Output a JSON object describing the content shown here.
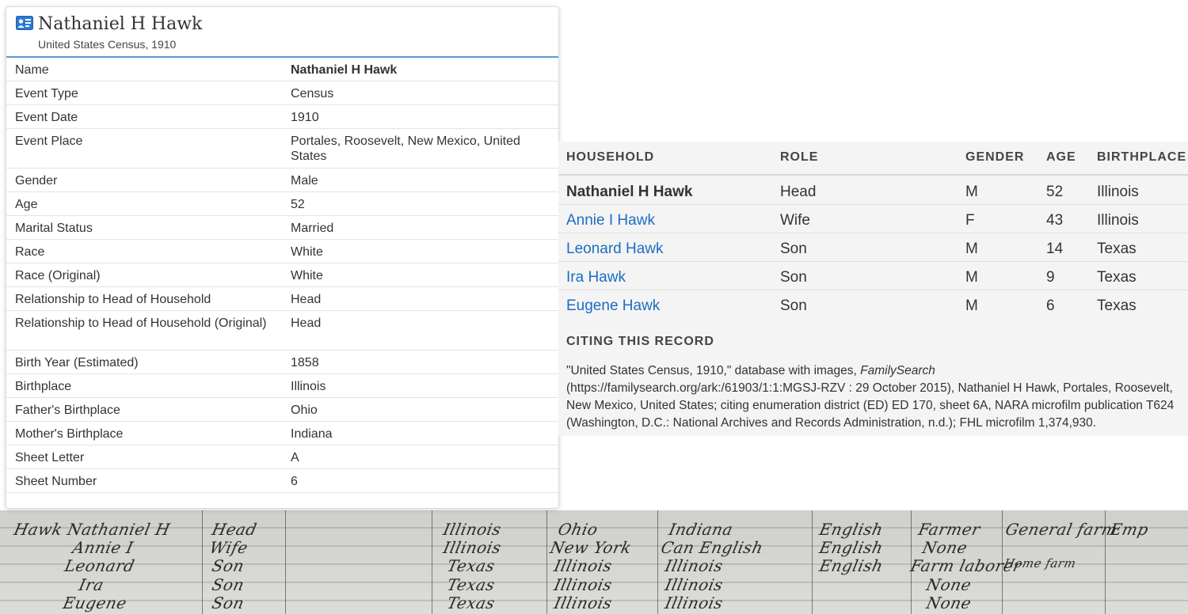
{
  "record": {
    "title": "Nathaniel H Hawk",
    "subtitle": "United States Census, 1910",
    "fields": [
      {
        "label": "Name",
        "value": "Nathaniel H Hawk"
      },
      {
        "label": "Event Type",
        "value": "Census"
      },
      {
        "label": "Event Date",
        "value": "1910"
      },
      {
        "label": "Event Place",
        "value": "Portales, Roosevelt, New Mexico, United States"
      },
      {
        "label": "Gender",
        "value": "Male"
      },
      {
        "label": "Age",
        "value": "52"
      },
      {
        "label": "Marital Status",
        "value": "Married"
      },
      {
        "label": "Race",
        "value": "White"
      },
      {
        "label": "Race (Original)",
        "value": "White"
      },
      {
        "label": "Relationship to Head of Household",
        "value": "Head"
      },
      {
        "label": "Relationship to Head of Household (Original)",
        "value": "Head"
      },
      {
        "label": "Birth Year (Estimated)",
        "value": "1858"
      },
      {
        "label": "Birthplace",
        "value": "Illinois"
      },
      {
        "label": "Father's Birthplace",
        "value": "Ohio"
      },
      {
        "label": "Mother's Birthplace",
        "value": "Indiana"
      },
      {
        "label": "Sheet Letter",
        "value": "A"
      },
      {
        "label": "Sheet Number",
        "value": "6"
      }
    ]
  },
  "household": {
    "headers": {
      "household": "HOUSEHOLD",
      "role": "ROLE",
      "gender": "GENDER",
      "age": "AGE",
      "birthplace": "BIRTHPLACE"
    },
    "members": [
      {
        "name": "Nathaniel H Hawk",
        "role": "Head",
        "gender": "M",
        "age": "52",
        "birthplace": "Illinois"
      },
      {
        "name": "Annie I Hawk",
        "role": "Wife",
        "gender": "F",
        "age": "43",
        "birthplace": "Illinois"
      },
      {
        "name": "Leonard Hawk",
        "role": "Son",
        "gender": "M",
        "age": "14",
        "birthplace": "Texas"
      },
      {
        "name": "Ira Hawk",
        "role": "Son",
        "gender": "M",
        "age": "9",
        "birthplace": "Texas"
      },
      {
        "name": "Eugene Hawk",
        "role": "Son",
        "gender": "M",
        "age": "6",
        "birthplace": "Texas"
      }
    ]
  },
  "citation": {
    "title": "CITING THIS RECORD",
    "before": "\"United States Census, 1910,\" database with images, ",
    "source": "FamilySearch",
    "after": " (https://familysearch.org/ark:/61903/1:1:MGSJ-RZV : 29 October 2015), Nathaniel H Hawk, Portales, Roosevelt, New Mexico, United States; citing enumeration district (ED) ED 170, sheet 6A, NARA microfilm publication T624 (Washington, D.C.: National Archives and Records Administration, n.d.); FHL microfilm 1,374,930."
  },
  "scan": {
    "entries": [
      "Hawk Nathaniel H",
      "Annie I",
      "Leonard",
      "Ira",
      "Eugene",
      "Head",
      "Wife",
      "Son",
      "Son",
      "Son",
      "Illinois",
      "Illinois",
      "Texas",
      "Texas",
      "Texas",
      "Ohio",
      "New York",
      "Illinois",
      "Illinois",
      "Illinois",
      "Indiana",
      "Can English",
      "Illinois",
      "Illinois",
      "Illinois",
      "English",
      "English",
      "English",
      "Farmer",
      "None",
      "Farm laborer",
      "None",
      "None",
      "General farm",
      "Home farm",
      "Emp"
    ]
  }
}
